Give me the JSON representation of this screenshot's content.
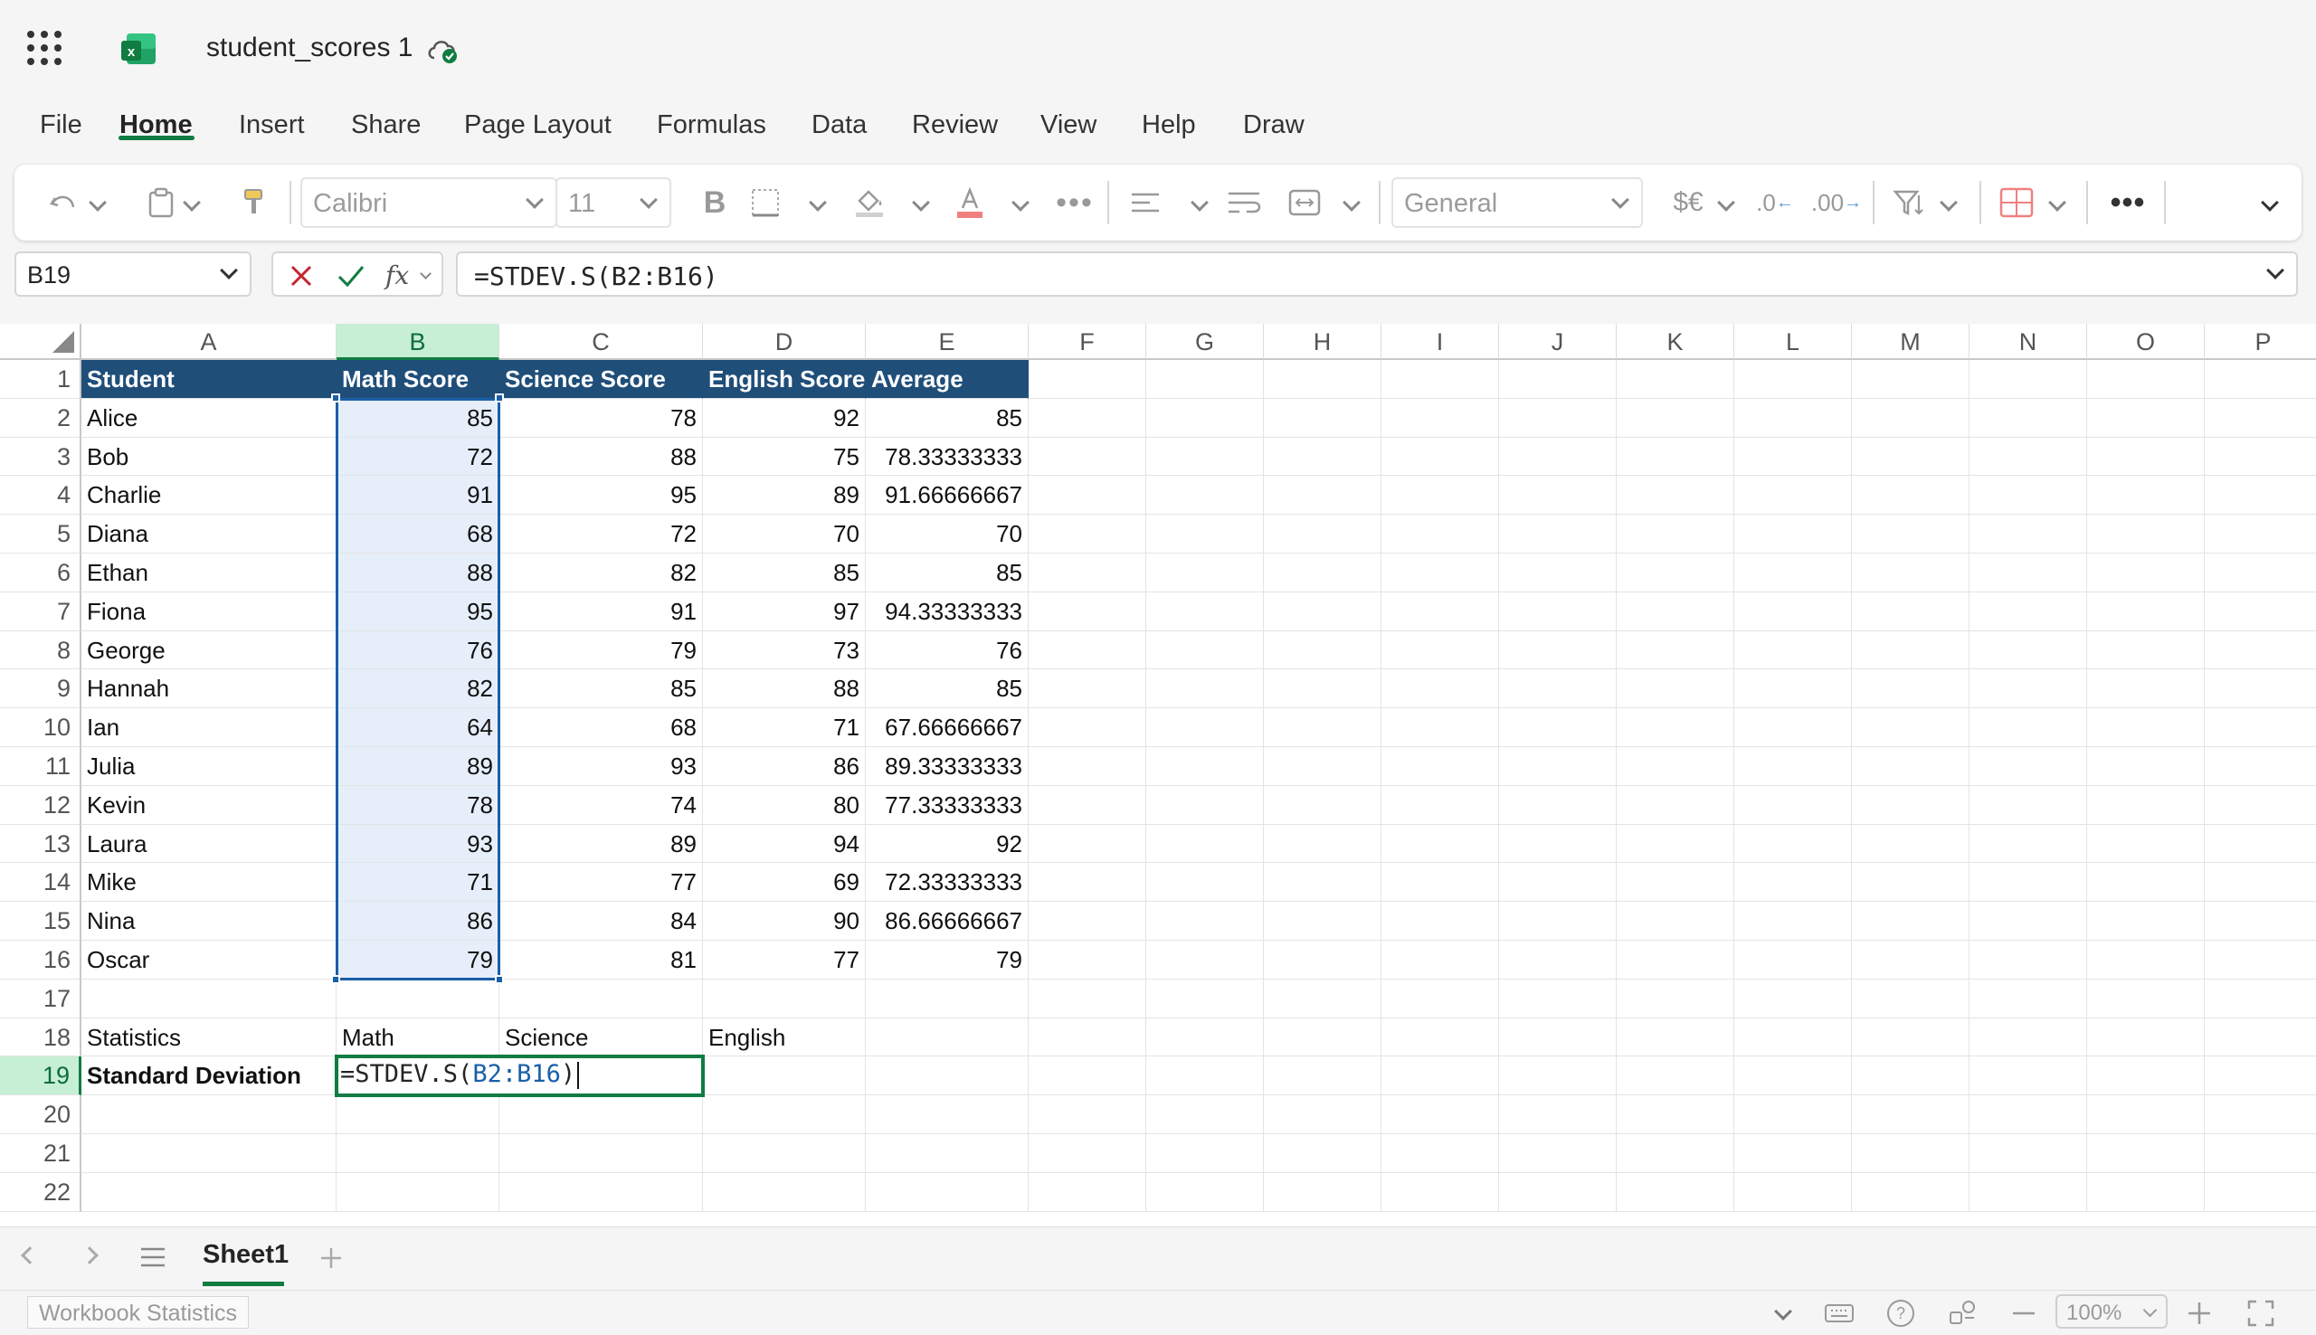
{
  "title_bar": {
    "doc_title": "student_scores 1",
    "icons": [
      "app-launcher-icon",
      "excel-logo-icon",
      "cloud-saved-icon"
    ]
  },
  "menu": {
    "items": [
      "File",
      "Home",
      "Insert",
      "Share",
      "Page Layout",
      "Formulas",
      "Data",
      "Review",
      "View",
      "Help",
      "Draw"
    ],
    "active": "Home"
  },
  "ribbon": {
    "font_name": "Calibri",
    "font_size": "11",
    "number_format": "General",
    "icons": [
      "undo-icon",
      "paste-icon",
      "format-painter-icon",
      "bold-icon",
      "borders-icon",
      "fill-color-icon",
      "font-color-icon",
      "more-icon",
      "align-icon",
      "wrap-text-icon",
      "merge-icon",
      "currency-icon",
      "decrease-decimal-icon",
      "increase-decimal-icon",
      "sort-filter-icon",
      "cell-styles-icon",
      "overflow-icon",
      "collapse-ribbon-icon"
    ]
  },
  "formula_bar": {
    "name_box": "B19",
    "fx_label": "fx",
    "formula": "=STDEV.S(B2:B16)"
  },
  "grid": {
    "columns": [
      "A",
      "B",
      "C",
      "D",
      "E",
      "F",
      "G",
      "H",
      "I",
      "J",
      "K",
      "L",
      "M",
      "N",
      "O",
      "P"
    ],
    "selected_column": "B",
    "row_numbers": [
      "1",
      "2",
      "3",
      "4",
      "5",
      "6",
      "7",
      "8",
      "9",
      "10",
      "11",
      "12",
      "13",
      "14",
      "15",
      "16",
      "17",
      "18",
      "19",
      "20",
      "21",
      "22"
    ],
    "selected_row": "19",
    "header_row": [
      "Student",
      "Math Score",
      "Science Score",
      "English Score",
      "Average"
    ],
    "rows": [
      [
        "Alice",
        "85",
        "78",
        "92",
        "85"
      ],
      [
        "Bob",
        "72",
        "88",
        "75",
        "78.33333333"
      ],
      [
        "Charlie",
        "91",
        "95",
        "89",
        "91.66666667"
      ],
      [
        "Diana",
        "68",
        "72",
        "70",
        "70"
      ],
      [
        "Ethan",
        "88",
        "82",
        "85",
        "85"
      ],
      [
        "Fiona",
        "95",
        "91",
        "97",
        "94.33333333"
      ],
      [
        "George",
        "76",
        "79",
        "73",
        "76"
      ],
      [
        "Hannah",
        "82",
        "85",
        "88",
        "85"
      ],
      [
        "Ian",
        "64",
        "68",
        "71",
        "67.66666667"
      ],
      [
        "Julia",
        "89",
        "93",
        "86",
        "89.33333333"
      ],
      [
        "Kevin",
        "78",
        "74",
        "80",
        "77.33333333"
      ],
      [
        "Laura",
        "93",
        "89",
        "94",
        "92"
      ],
      [
        "Mike",
        "71",
        "77",
        "69",
        "72.33333333"
      ],
      [
        "Nina",
        "86",
        "84",
        "90",
        "86.66666667"
      ],
      [
        "Oscar",
        "79",
        "81",
        "77",
        "79"
      ]
    ],
    "stats_row": [
      "Statistics",
      "Math",
      "Science",
      "English"
    ],
    "stdev_label": "Standard Deviation",
    "edit_prefix": "=STDEV.S(",
    "edit_ref": "B2:B16",
    "edit_suffix": ")"
  },
  "sheet_tabs": {
    "tabs": [
      "Sheet1"
    ],
    "active": "Sheet1"
  },
  "status_bar": {
    "workbook_statistics": "Workbook Statistics",
    "zoom": "100%"
  },
  "colors": {
    "accent": "#107c41",
    "header_fill": "#1f4e79",
    "selection_border": "#1a5fa8",
    "selection_fill": "#e6eefa"
  }
}
